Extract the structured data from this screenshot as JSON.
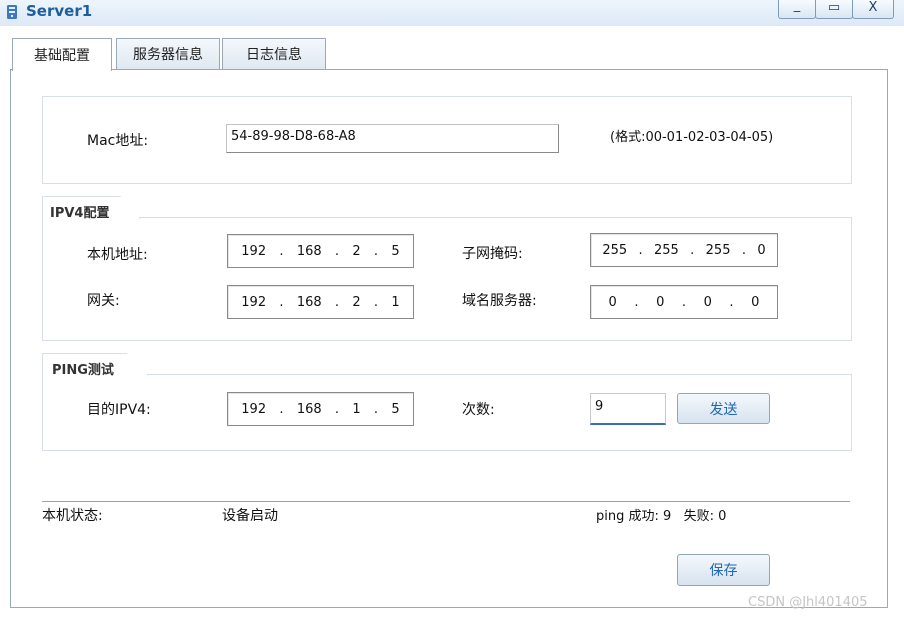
{
  "window": {
    "title": "Server1",
    "minimize": "_",
    "maximize": "▭",
    "close": "X"
  },
  "tabs": [
    {
      "label": "基础配置"
    },
    {
      "label": "服务器信息"
    },
    {
      "label": "日志信息"
    }
  ],
  "mac": {
    "label": "Mac地址:",
    "value": "54-89-98-D8-68-A8",
    "hint": "(格式:00-01-02-03-04-05)"
  },
  "ipv4": {
    "title": "IPV4配置",
    "local_label": "本机地址:",
    "local": [
      "192",
      "168",
      "2",
      "5"
    ],
    "mask_label": "子网掩码:",
    "mask": [
      "255",
      "255",
      "255",
      "0"
    ],
    "gateway_label": "网关:",
    "gateway": [
      "192",
      "168",
      "2",
      "1"
    ],
    "dns_label": "域名服务器:",
    "dns": [
      "0",
      "0",
      "0",
      "0"
    ]
  },
  "ping": {
    "title": "PING测试",
    "target_label": "目的IPV4:",
    "target": [
      "192",
      "168",
      "1",
      "5"
    ],
    "count_label": "次数:",
    "count": "9",
    "send": "发送"
  },
  "status": {
    "label": "本机状态:",
    "value": "设备启动",
    "ping_result": "ping 成功: 9   失败: 0"
  },
  "save": "保存",
  "watermark": "CSDN @Jhl401405"
}
